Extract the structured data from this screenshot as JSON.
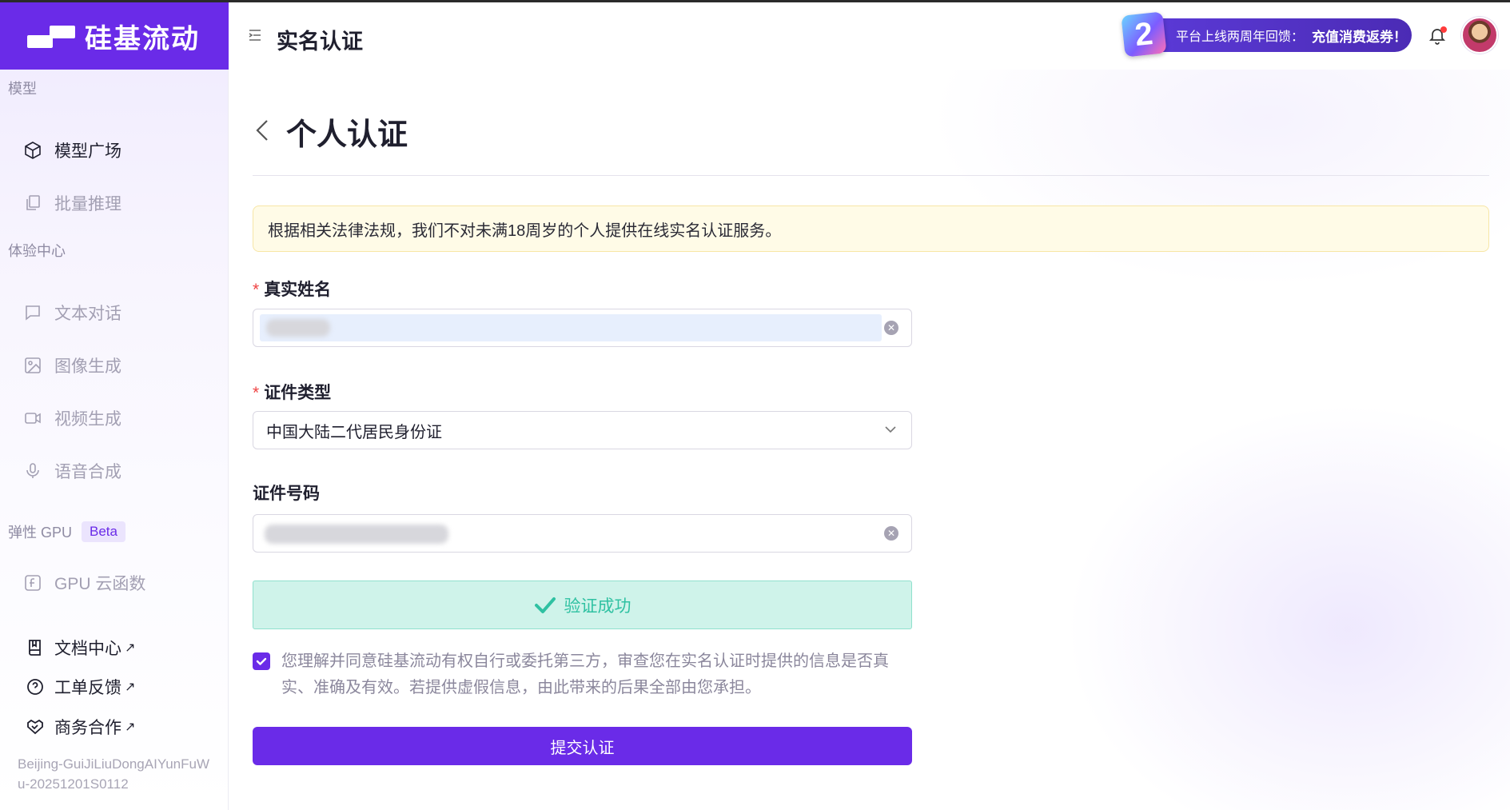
{
  "app": {
    "brand": "硅基流动",
    "page_title": "实名认证"
  },
  "sidebar": {
    "section_model": "模型",
    "model_items": [
      {
        "label": "模型广场",
        "icon": "cube-icon"
      },
      {
        "label": "批量推理",
        "icon": "copy-icon"
      }
    ],
    "section_experience": "体验中心",
    "experience_items": [
      {
        "label": "文本对话",
        "icon": "chat-icon"
      },
      {
        "label": "图像生成",
        "icon": "image-icon"
      },
      {
        "label": "视频生成",
        "icon": "video-icon"
      },
      {
        "label": "语音合成",
        "icon": "mic-icon"
      }
    ],
    "section_gpu": "弹性 GPU",
    "gpu_badge": "Beta",
    "gpu_items": [
      {
        "label": "GPU 云函数",
        "icon": "function-icon"
      }
    ],
    "links": [
      {
        "label": "文档中心",
        "icon": "book-icon",
        "arrow": "↗"
      },
      {
        "label": "工单反馈",
        "icon": "help-circle-icon",
        "arrow": "↗"
      },
      {
        "label": "商务合作",
        "icon": "handshake-icon",
        "arrow": "↗"
      }
    ],
    "build_id": "Beijing-GuiJiLiuDongAIYunFuWu-20251201S0112"
  },
  "topbar": {
    "promo_badge": "2",
    "promo_text": "平台上线两周年回馈：",
    "promo_highlight": "充值消费返券！"
  },
  "main": {
    "heading": "个人认证",
    "notice": "根据相关法律法规，我们不对未满18周岁的个人提供在线实名认证服务。",
    "name_label": "真实姓名",
    "id_type_label": "证件类型",
    "id_type_value": "中国大陆二代居民身份证",
    "id_number_label": "证件号码",
    "required_mark": "*",
    "success_text": "验证成功",
    "agreement": "您理解并同意硅基流动有权自行或委托第三方，审查您在实名认证时提供的信息是否真实、准确及有效。若提供虚假信息，由此带来的后果全部由您承担。",
    "agreement_checked": true,
    "submit_label": "提交认证"
  },
  "colors": {
    "brand": "#6a2be8",
    "success_bg": "#cff3ea",
    "success_text": "#2fc1a2",
    "notice_bg": "#fffbe7"
  }
}
